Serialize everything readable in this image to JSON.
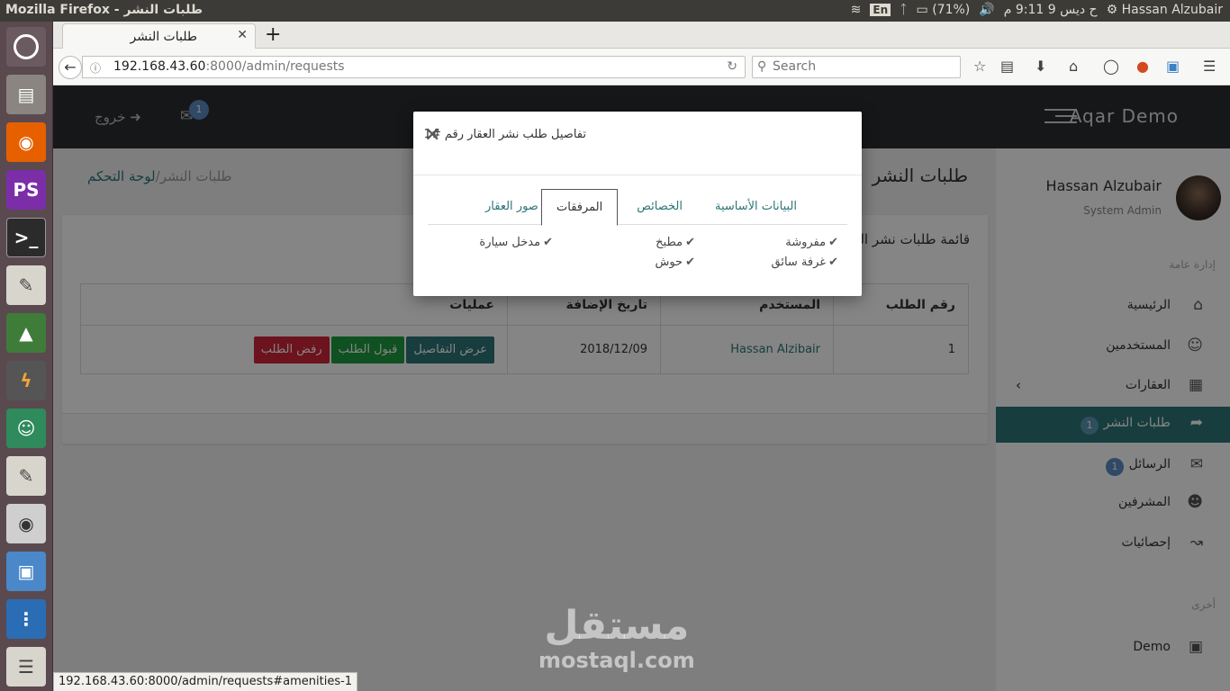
{
  "os": {
    "window_title": "Mozilla Firefox - طلبات النشر",
    "keyboard": "En",
    "battery": "(71%)",
    "datetime": "ح ديس 9 9:11 م",
    "user": "Hassan Alzubair"
  },
  "browser": {
    "tab_title": "طلبات النشر",
    "url_host": "192.168.43.60",
    "url_rest": ":8000/admin/requests",
    "search_placeholder": "Search",
    "status_url": "192.168.43.60:8000/admin/requests#amenities-1"
  },
  "header": {
    "brand": "Aqar Demo",
    "logout_label": "خروج",
    "mail_count": "1"
  },
  "sidebar": {
    "user_name": "Hassan Alzubair",
    "user_role": "System Admin",
    "group_main": "إدارة عامة",
    "group_other": "أخرى",
    "items": [
      {
        "label": "الرئيسية",
        "icon": "home-icon"
      },
      {
        "label": "المستخدمين",
        "icon": "user-icon"
      },
      {
        "label": "العقارات",
        "icon": "building-icon"
      },
      {
        "label": "طلبات النشر",
        "icon": "share-icon",
        "badge": "1"
      },
      {
        "label": "الرسائل",
        "icon": "envelope-icon",
        "badge": "1"
      },
      {
        "label": "المشرفين",
        "icon": "users-icon"
      },
      {
        "label": "إحصائيات",
        "icon": "chart-line-icon"
      },
      {
        "label": "Demo",
        "icon": "image-icon"
      }
    ]
  },
  "main": {
    "page_title": "طلبات النشر",
    "breadcrumb_home": "لوحة التحكم",
    "breadcrumb_current": "طلبات النشر",
    "panel_title": "قائمة طلبات نشر العقارات",
    "table": {
      "headers": [
        "رقم الطلب",
        "المستخدم",
        "تاريخ الإضافة",
        "عمليات"
      ],
      "rows": [
        {
          "id": "1",
          "user": "Hassan Alzibair",
          "date": "2018/12/09"
        }
      ]
    },
    "actions": {
      "details": "عرض التفاصيل",
      "accept": "قبول الطلب",
      "reject": "رفض الطلب"
    }
  },
  "modal": {
    "title": "تفاصيل طلب نشر العقار رقم #1",
    "tabs": [
      "البيانات الأساسية",
      "الخصائص",
      "المرفقات",
      "صور العقار"
    ],
    "active_tab": "المرفقات",
    "amenities": [
      "مفروشة",
      "مطبخ",
      "مدخل سيارة",
      "غرفة سائق",
      "حوش"
    ]
  },
  "watermark": {
    "arabic": "مستقل",
    "latin": "mostaql.com"
  }
}
